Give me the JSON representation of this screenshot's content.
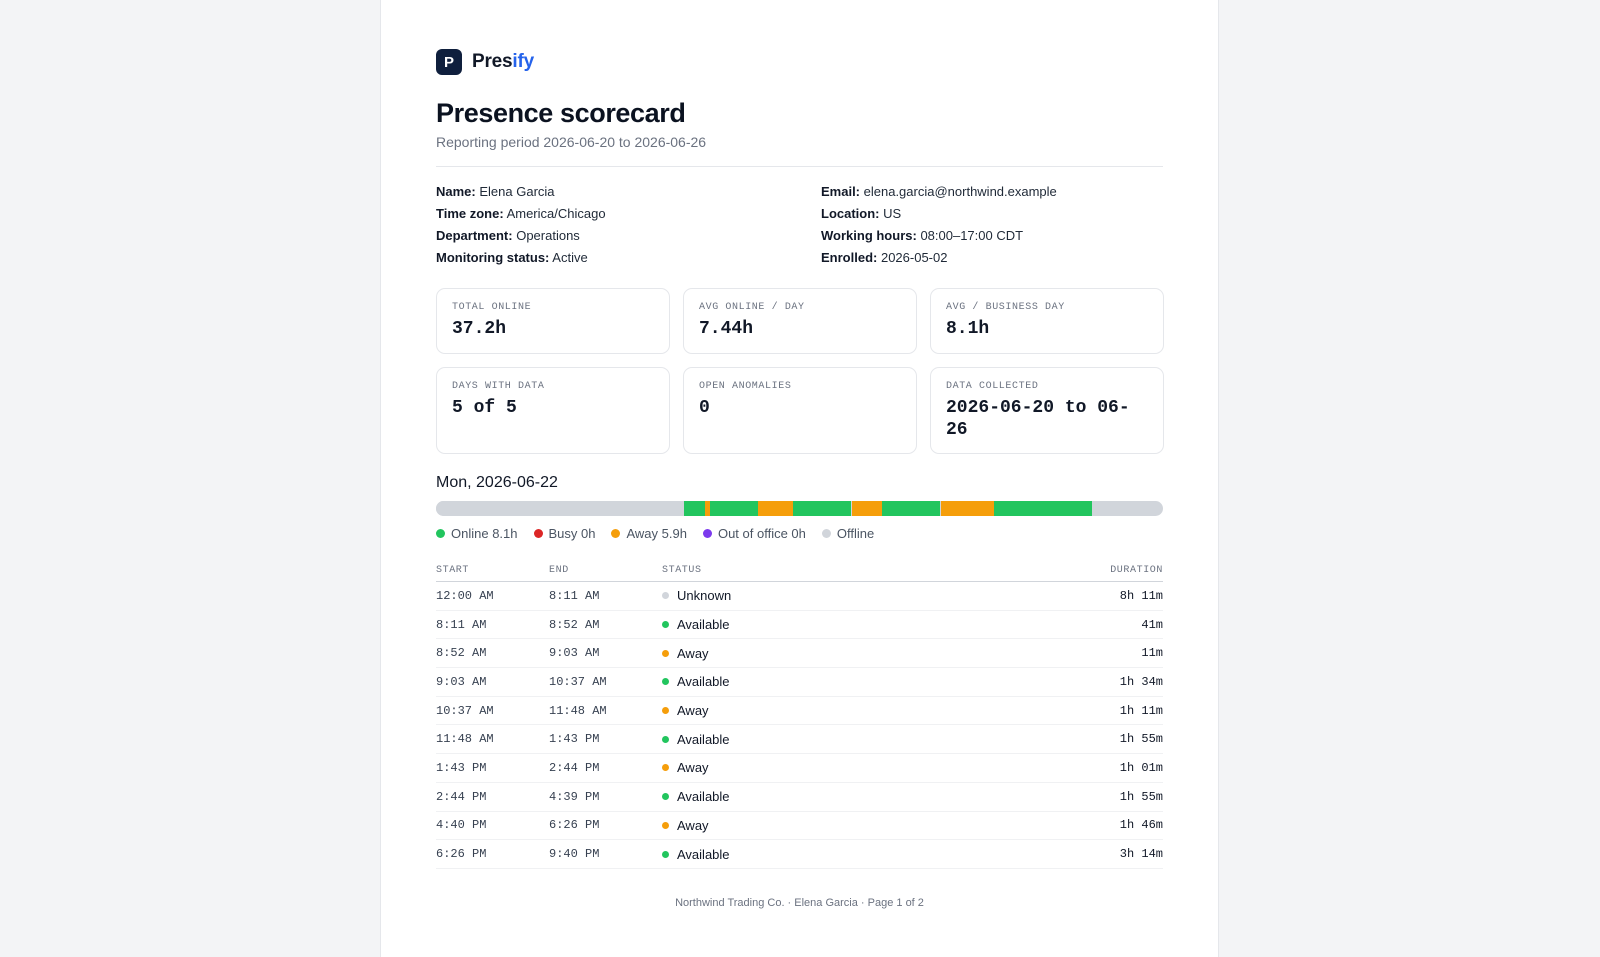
{
  "brand": {
    "logo_letter": "P",
    "name_part1": "Pres",
    "name_part2": "ify"
  },
  "header": {
    "title": "Presence scorecard",
    "subtitle": "Reporting period 2026-06-20 to 2026-06-26"
  },
  "info": {
    "left": [
      {
        "label": "Name:",
        "value": "Elena Garcia"
      },
      {
        "label": "Time zone:",
        "value": "America/Chicago"
      },
      {
        "label": "Department:",
        "value": "Operations"
      },
      {
        "label": "Monitoring status:",
        "value": "Active"
      }
    ],
    "right": [
      {
        "label": "Email:",
        "value": "elena.garcia@northwind.example"
      },
      {
        "label": "Location:",
        "value": "US"
      },
      {
        "label": "Working hours:",
        "value": "08:00–17:00 CDT"
      },
      {
        "label": "Enrolled:",
        "value": "2026-05-02"
      }
    ]
  },
  "cards": [
    {
      "label": "Total online",
      "value": "37.2h"
    },
    {
      "label": "Avg online / day",
      "value": "7.44h"
    },
    {
      "label": "Avg / business day",
      "value": "8.1h"
    },
    {
      "label": "Days with data",
      "value": "5 of 5"
    },
    {
      "label": "Open anomalies",
      "value": "0"
    },
    {
      "label": "Data collected",
      "value": "2026-06-20 to 06-26"
    }
  ],
  "day": {
    "title": "Mon, 2026-06-22",
    "legend": [
      {
        "label": "Online 8.1h",
        "color": "#22c55e"
      },
      {
        "label": "Busy 0h",
        "color": "#dc2626"
      },
      {
        "label": "Away 5.9h",
        "color": "#f59e0b"
      },
      {
        "label": "Out of office 0h",
        "color": "#7c3aed"
      },
      {
        "label": "Offline",
        "color": "#d1d5db"
      }
    ],
    "timeline_minutes_total": 1440,
    "colors": {
      "Unknown": "#d1d5db",
      "Available": "#22c55e",
      "Away": "#f59e0b"
    },
    "table_headers": {
      "start": "Start",
      "end": "End",
      "status": "Status",
      "duration": "Duration"
    },
    "rows": [
      {
        "start": "12:00 AM",
        "end": "8:11 AM",
        "status": "Unknown",
        "duration": "8h 11m",
        "start_min": 0,
        "end_min": 491
      },
      {
        "start": "8:11 AM",
        "end": "8:52 AM",
        "status": "Available",
        "duration": "41m",
        "start_min": 491,
        "end_min": 532
      },
      {
        "start": "8:52 AM",
        "end": "9:03 AM",
        "status": "Away",
        "duration": "11m",
        "start_min": 532,
        "end_min": 543
      },
      {
        "start": "9:03 AM",
        "end": "10:37 AM",
        "status": "Available",
        "duration": "1h 34m",
        "start_min": 543,
        "end_min": 637
      },
      {
        "start": "10:37 AM",
        "end": "11:48 AM",
        "status": "Away",
        "duration": "1h 11m",
        "start_min": 637,
        "end_min": 708
      },
      {
        "start": "11:48 AM",
        "end": "1:43 PM",
        "status": "Available",
        "duration": "1h 55m",
        "start_min": 708,
        "end_min": 823
      },
      {
        "start": "1:43 PM",
        "end": "2:44 PM",
        "status": "Away",
        "duration": "1h 01m",
        "start_min": 823,
        "end_min": 884
      },
      {
        "start": "2:44 PM",
        "end": "4:39 PM",
        "status": "Available",
        "duration": "1h 55m",
        "start_min": 884,
        "end_min": 999
      },
      {
        "start": "4:40 PM",
        "end": "6:26 PM",
        "status": "Away",
        "duration": "1h 46m",
        "start_min": 1000,
        "end_min": 1106
      },
      {
        "start": "6:26 PM",
        "end": "9:40 PM",
        "status": "Available",
        "duration": "3h 14m",
        "start_min": 1106,
        "end_min": 1300
      }
    ]
  },
  "footer": "Northwind Trading Co. · Elena Garcia · Page 1 of 2"
}
